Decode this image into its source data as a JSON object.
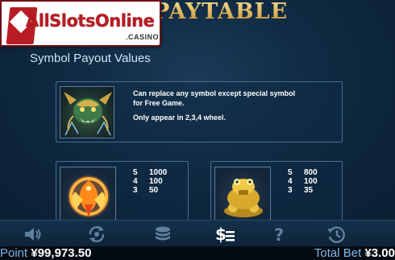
{
  "logo": {
    "text": "AllSlotsOnline",
    "sub": ".CASINO"
  },
  "title": "PAYTABLE",
  "section_title": "Symbol Payout Values",
  "wild": {
    "icon": "dragon-wild-icon",
    "line1": "Can replace any symbol except special symbol",
    "line2": "for Free Game.",
    "line3": "Only appear in 2,3,4 wheel."
  },
  "phoenix": {
    "icon": "phoenix-symbol-icon",
    "payouts": [
      {
        "count": "5",
        "value": "1000"
      },
      {
        "count": "4",
        "value": "100"
      },
      {
        "count": "3",
        "value": "50"
      }
    ]
  },
  "toad": {
    "icon": "golden-toad-symbol-icon",
    "payouts": [
      {
        "count": "5",
        "value": "800"
      },
      {
        "count": "4",
        "value": "100"
      },
      {
        "count": "3",
        "value": "35"
      }
    ]
  },
  "toolbar": {
    "items": [
      {
        "icon": "speaker-icon"
      },
      {
        "icon": "autoplay-icon"
      },
      {
        "icon": "coins-icon"
      },
      {
        "icon": "paytable-dollar-icon",
        "active": true
      },
      {
        "icon": "help-icon"
      },
      {
        "icon": "history-icon"
      }
    ]
  },
  "status": {
    "point_label": "Point",
    "point_value": "¥99,973.50",
    "bet_label": "Total Bet",
    "bet_value": "¥3.00"
  },
  "colors": {
    "title_gold": "#e3b45a",
    "panel_border": "#4a6f92",
    "status_label": "#7fb6e8",
    "logo_red": "#b81c24"
  }
}
